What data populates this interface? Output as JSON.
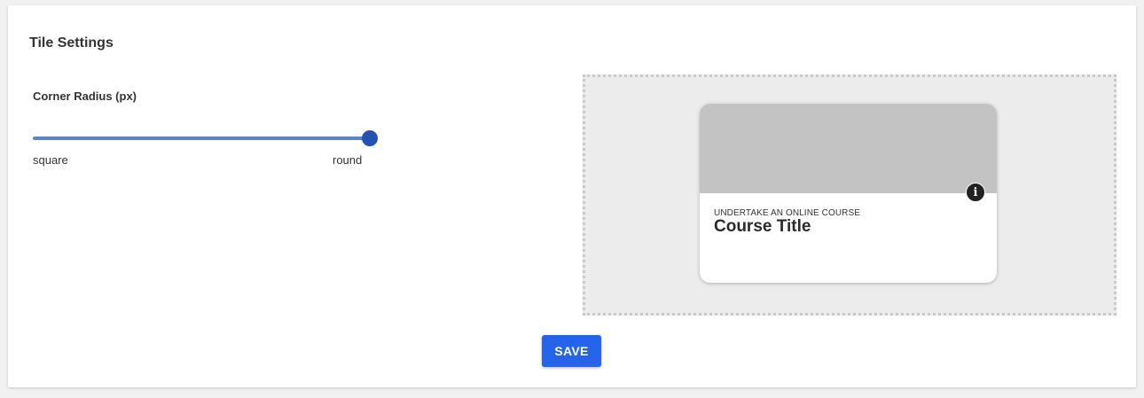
{
  "settings": {
    "title": "Tile Settings",
    "corner_radius": {
      "label": "Corner Radius (px)",
      "min_label": "square",
      "max_label": "round",
      "value_fraction": 1.0
    }
  },
  "preview": {
    "tile": {
      "eyebrow": "UNDERTAKE AN ONLINE COURSE",
      "title": "Course Title",
      "info_icon_glyph": "i"
    }
  },
  "actions": {
    "save_label": "SAVE"
  },
  "colors": {
    "accent": "#2563eb",
    "slider_thumb": "#2452b3",
    "slider_fill": "#5e85c6",
    "tile_image": "#c3c3c3",
    "preview_background": "#ececec"
  }
}
